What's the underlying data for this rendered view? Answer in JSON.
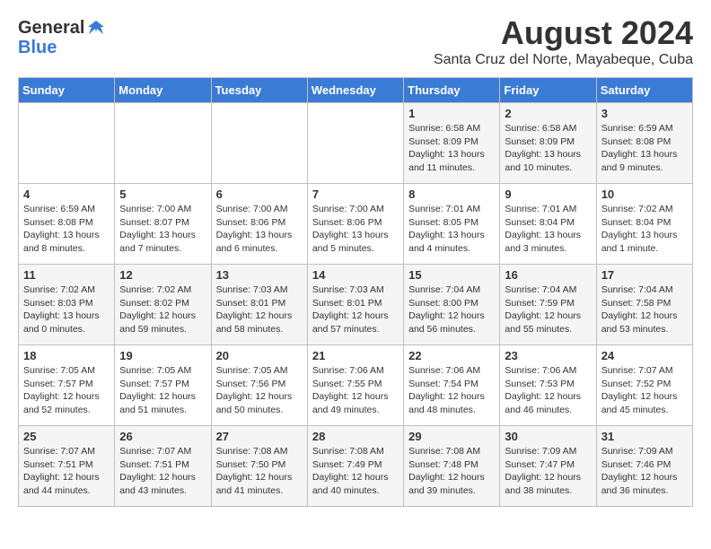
{
  "header": {
    "logo_general": "General",
    "logo_blue": "Blue",
    "main_title": "August 2024",
    "subtitle": "Santa Cruz del Norte, Mayabeque, Cuba"
  },
  "weekdays": [
    "Sunday",
    "Monday",
    "Tuesday",
    "Wednesday",
    "Thursday",
    "Friday",
    "Saturday"
  ],
  "weeks": [
    [
      {
        "day": "",
        "info": ""
      },
      {
        "day": "",
        "info": ""
      },
      {
        "day": "",
        "info": ""
      },
      {
        "day": "",
        "info": ""
      },
      {
        "day": "1",
        "info": "Sunrise: 6:58 AM\nSunset: 8:09 PM\nDaylight: 13 hours and 11 minutes."
      },
      {
        "day": "2",
        "info": "Sunrise: 6:58 AM\nSunset: 8:09 PM\nDaylight: 13 hours and 10 minutes."
      },
      {
        "day": "3",
        "info": "Sunrise: 6:59 AM\nSunset: 8:08 PM\nDaylight: 13 hours and 9 minutes."
      }
    ],
    [
      {
        "day": "4",
        "info": "Sunrise: 6:59 AM\nSunset: 8:08 PM\nDaylight: 13 hours and 8 minutes."
      },
      {
        "day": "5",
        "info": "Sunrise: 7:00 AM\nSunset: 8:07 PM\nDaylight: 13 hours and 7 minutes."
      },
      {
        "day": "6",
        "info": "Sunrise: 7:00 AM\nSunset: 8:06 PM\nDaylight: 13 hours and 6 minutes."
      },
      {
        "day": "7",
        "info": "Sunrise: 7:00 AM\nSunset: 8:06 PM\nDaylight: 13 hours and 5 minutes."
      },
      {
        "day": "8",
        "info": "Sunrise: 7:01 AM\nSunset: 8:05 PM\nDaylight: 13 hours and 4 minutes."
      },
      {
        "day": "9",
        "info": "Sunrise: 7:01 AM\nSunset: 8:04 PM\nDaylight: 13 hours and 3 minutes."
      },
      {
        "day": "10",
        "info": "Sunrise: 7:02 AM\nSunset: 8:04 PM\nDaylight: 13 hours and 1 minute."
      }
    ],
    [
      {
        "day": "11",
        "info": "Sunrise: 7:02 AM\nSunset: 8:03 PM\nDaylight: 13 hours and 0 minutes."
      },
      {
        "day": "12",
        "info": "Sunrise: 7:02 AM\nSunset: 8:02 PM\nDaylight: 12 hours and 59 minutes."
      },
      {
        "day": "13",
        "info": "Sunrise: 7:03 AM\nSunset: 8:01 PM\nDaylight: 12 hours and 58 minutes."
      },
      {
        "day": "14",
        "info": "Sunrise: 7:03 AM\nSunset: 8:01 PM\nDaylight: 12 hours and 57 minutes."
      },
      {
        "day": "15",
        "info": "Sunrise: 7:04 AM\nSunset: 8:00 PM\nDaylight: 12 hours and 56 minutes."
      },
      {
        "day": "16",
        "info": "Sunrise: 7:04 AM\nSunset: 7:59 PM\nDaylight: 12 hours and 55 minutes."
      },
      {
        "day": "17",
        "info": "Sunrise: 7:04 AM\nSunset: 7:58 PM\nDaylight: 12 hours and 53 minutes."
      }
    ],
    [
      {
        "day": "18",
        "info": "Sunrise: 7:05 AM\nSunset: 7:57 PM\nDaylight: 12 hours and 52 minutes."
      },
      {
        "day": "19",
        "info": "Sunrise: 7:05 AM\nSunset: 7:57 PM\nDaylight: 12 hours and 51 minutes."
      },
      {
        "day": "20",
        "info": "Sunrise: 7:05 AM\nSunset: 7:56 PM\nDaylight: 12 hours and 50 minutes."
      },
      {
        "day": "21",
        "info": "Sunrise: 7:06 AM\nSunset: 7:55 PM\nDaylight: 12 hours and 49 minutes."
      },
      {
        "day": "22",
        "info": "Sunrise: 7:06 AM\nSunset: 7:54 PM\nDaylight: 12 hours and 48 minutes."
      },
      {
        "day": "23",
        "info": "Sunrise: 7:06 AM\nSunset: 7:53 PM\nDaylight: 12 hours and 46 minutes."
      },
      {
        "day": "24",
        "info": "Sunrise: 7:07 AM\nSunset: 7:52 PM\nDaylight: 12 hours and 45 minutes."
      }
    ],
    [
      {
        "day": "25",
        "info": "Sunrise: 7:07 AM\nSunset: 7:51 PM\nDaylight: 12 hours and 44 minutes."
      },
      {
        "day": "26",
        "info": "Sunrise: 7:07 AM\nSunset: 7:51 PM\nDaylight: 12 hours and 43 minutes."
      },
      {
        "day": "27",
        "info": "Sunrise: 7:08 AM\nSunset: 7:50 PM\nDaylight: 12 hours and 41 minutes."
      },
      {
        "day": "28",
        "info": "Sunrise: 7:08 AM\nSunset: 7:49 PM\nDaylight: 12 hours and 40 minutes."
      },
      {
        "day": "29",
        "info": "Sunrise: 7:08 AM\nSunset: 7:48 PM\nDaylight: 12 hours and 39 minutes."
      },
      {
        "day": "30",
        "info": "Sunrise: 7:09 AM\nSunset: 7:47 PM\nDaylight: 12 hours and 38 minutes."
      },
      {
        "day": "31",
        "info": "Sunrise: 7:09 AM\nSunset: 7:46 PM\nDaylight: 12 hours and 36 minutes."
      }
    ]
  ]
}
